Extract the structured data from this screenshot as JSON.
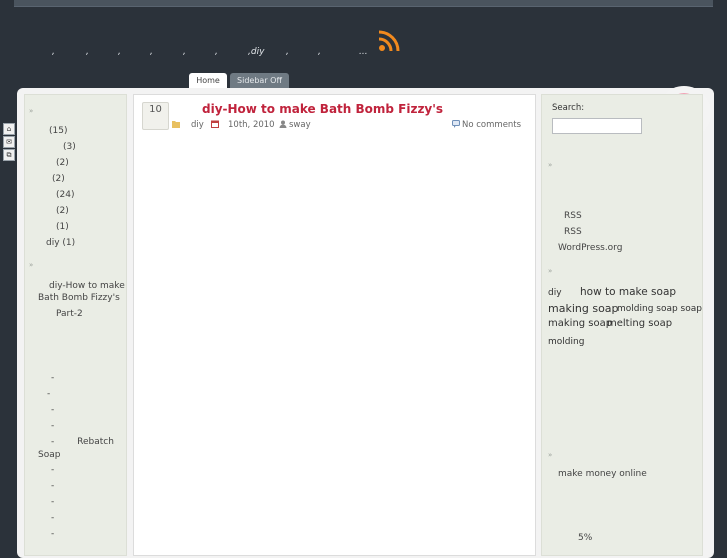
{
  "header": {
    "tagline_parts": [
      ",",
      ",",
      ",",
      ",",
      ",",
      ",",
      ",diy",
      ",",
      ",",
      "..."
    ],
    "rss_icon": "rss-icon",
    "accent": "#f28a1e"
  },
  "nav": {
    "tabs": [
      {
        "label": "Home"
      },
      {
        "label": "Sidebar Off"
      }
    ]
  },
  "side_icons": [
    "home-icon",
    "mail-icon",
    "bookmark-icon"
  ],
  "left_sidebar": {
    "categories": [
      "(15)",
      "(3)",
      "(2)",
      "(2)",
      "(24)",
      "(2)",
      "(1)",
      "diy (1)"
    ],
    "recent_posts": [
      "diy-How to make",
      "Bath Bomb Fizzy's",
      "Part-2"
    ],
    "links": [
      "-",
      "-",
      "-",
      "-",
      "-        Rebatch",
      "Soap",
      "-",
      "-",
      "-",
      "-",
      "-"
    ]
  },
  "post": {
    "date": "10",
    "title": "diy-How to make Bath Bomb Fizzy's",
    "category": "diy",
    "date_text": "10th, 2010",
    "author": "sway",
    "comments": "No comments",
    "title_color": "#c0233c"
  },
  "right_sidebar": {
    "search_label": "Search:",
    "search_value": "",
    "meta_links": [
      "RSS",
      "RSS",
      "WordPress.org"
    ],
    "tags": [
      {
        "text": "diy"
      },
      {
        "text": "how to make soap"
      },
      {
        "text": "making soap"
      },
      {
        "text": "molding soap soap"
      },
      {
        "text": "making soap"
      },
      {
        "text": "melting soap"
      },
      {
        "text": "molding"
      }
    ],
    "blogroll": [
      "make money online"
    ],
    "percent": "5%"
  }
}
